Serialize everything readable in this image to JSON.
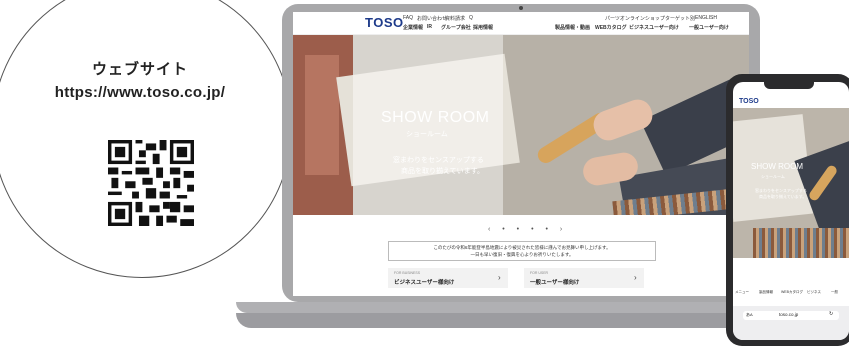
{
  "website_info": {
    "title": "ウェブサイト",
    "url": "https://www.toso.co.jp/"
  },
  "laptop_site": {
    "logo": "TOSO",
    "top_links": [
      "FAQ",
      "お問い合わせ",
      "資料請求",
      "Q"
    ],
    "top_right": [
      "パーツオンラインショップ",
      "ターゲット別",
      "ENGLISH"
    ],
    "nav_left": [
      "企業情報",
      "IR",
      "グループ会社",
      "採用情報"
    ],
    "nav_right": [
      "製品情報・動画",
      "WEBカタログ",
      "ビジネスユーザー向け",
      "一般ユーザー向け"
    ],
    "hero": {
      "title": "SHOW ROOM",
      "subtitle": "ショールーム",
      "line1": "窓まわりをセンスアップする",
      "line2": "商品を取り揃えています。"
    },
    "pager": "‹ • • • • ›",
    "notice_line1": "このたびの令和6年能登半島地震により被災された皆様に謹んでお見舞い申し上げます。",
    "notice_line2": "一日も早い復旧・復興を心よりお祈りいたします。",
    "cards": [
      {
        "small": "FOR BUSINESS",
        "label": "ビジネスユーザー様向け",
        "arrow": "›"
      },
      {
        "small": "FOR USER",
        "label": "一般ユーザー様向け",
        "arrow": "›"
      }
    ]
  },
  "phone_site": {
    "logo": "TOSO",
    "hero_title": "SHOW ROOM",
    "hero_subtitle": "ショールーム",
    "hero_line1": "窓まわりをセンスアップする",
    "hero_line2": "商品を取り揃えています。",
    "bottom_nav": [
      "メニュー",
      "製品情報",
      "WEBカタログ",
      "ビジネス",
      "一般"
    ],
    "url_text": "toso.co.jp",
    "aa": "あA",
    "reload": "↻"
  }
}
